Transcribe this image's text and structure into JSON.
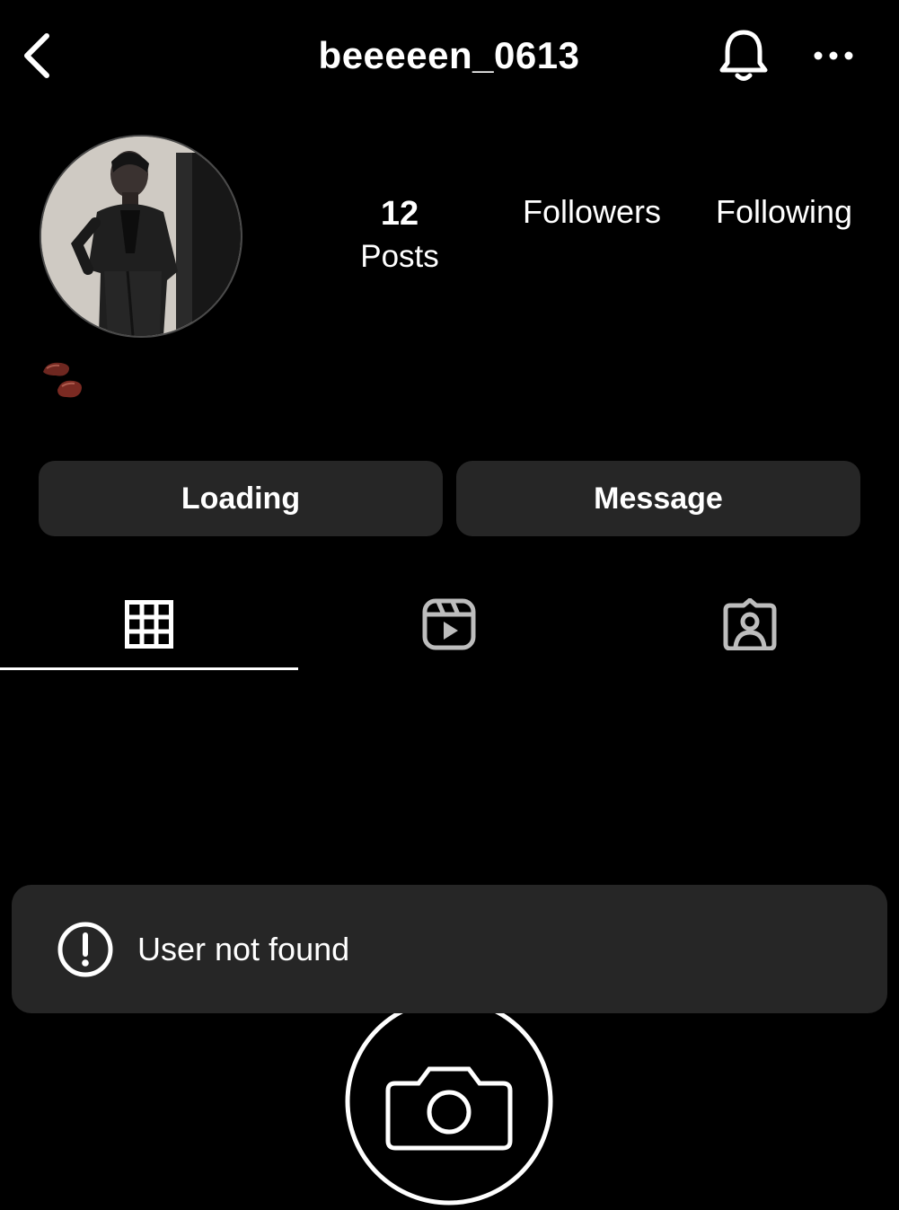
{
  "header": {
    "username": "beeeeen_0613",
    "back_icon": "chevron-left-icon",
    "bell_icon": "bell-icon",
    "more_icon": "more-horizontal-icon"
  },
  "profile": {
    "avatar_icon": "profile-photo",
    "stats": {
      "posts_count": "12",
      "posts_label": "Posts",
      "followers_label": "Followers",
      "following_label": "Following"
    },
    "bio": "🫘"
  },
  "actions": {
    "loading_label": "Loading",
    "message_label": "Message"
  },
  "tabs": [
    {
      "icon": "grid-icon",
      "active": true
    },
    {
      "icon": "reels-icon",
      "active": false
    },
    {
      "icon": "tagged-icon",
      "active": false
    }
  ],
  "toast": {
    "icon": "alert-circle-icon",
    "text": "User not found"
  },
  "colors": {
    "background": "#000000",
    "surface": "#262626",
    "text": "#ffffff",
    "icon_muted": "#bdbdbd",
    "bean_red": "#7a2a22"
  }
}
